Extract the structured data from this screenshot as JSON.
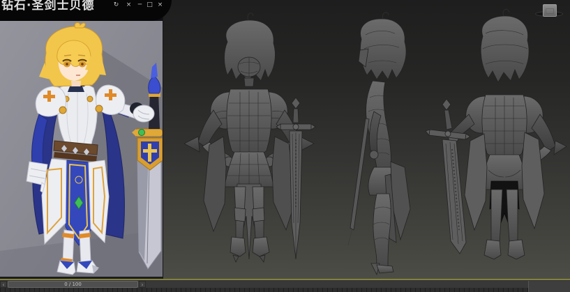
{
  "reference_window": {
    "title": "钻石·圣剑士贝德",
    "controls": {
      "pin": "↻",
      "close_small": "×",
      "minimize": "─",
      "maximize": "□",
      "close": "×"
    },
    "description": "colored concept art of blonde knight girl in white-blue armor holding a greatsword"
  },
  "viewport": {
    "viewcube": "view-cube",
    "model_views": [
      "front",
      "side",
      "back"
    ]
  },
  "timeline": {
    "frame_label": "0 / 100",
    "prev": "‹",
    "next": "›"
  },
  "colors": {
    "viewport_top": "#1e1e1e",
    "viewport_bottom": "#4d4d47",
    "active_viewport_border": "#82823c",
    "titlebar_bg": "#060606",
    "armor_blue": "#3448bc",
    "trim_gold": "#e0a23a",
    "hair_gold": "#f2c64a",
    "wireframe_gray": "#5c5c5c"
  }
}
